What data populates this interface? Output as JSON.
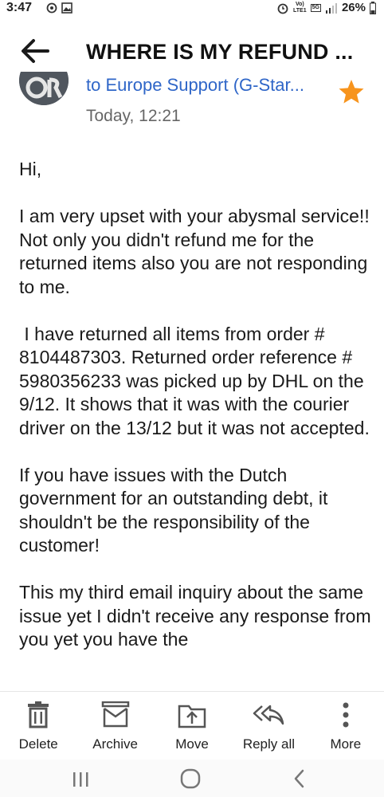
{
  "status_bar": {
    "time": "3:47",
    "volte_label": "Vo)",
    "lte_label": "LTE1",
    "network_label": "5G",
    "battery_percent": "26%"
  },
  "header": {
    "title": "WHERE IS MY REFUND ..."
  },
  "message": {
    "to_word": "to",
    "recipient": "Europe Support (G-Star...",
    "date": "Today, 12:21",
    "starred": true,
    "paragraphs": [
      "Hi,",
      "I am very upset with your abysmal service!! Not only you didn't refund me for the returned items also you are not responding to me.",
      " I have returned all items from order # 8104487303. Returned order reference # 5980356233 was picked up by DHL on the 9/12. It shows that it was with the courier driver on the 13/12 but it was not accepted.",
      "If you have issues with the Dutch government for an outstanding debt, it shouldn't be the responsibility of the customer!",
      "This my third email inquiry about the same issue yet I didn't receive any response from you yet you have the"
    ]
  },
  "toolbar": {
    "delete_label": "Delete",
    "archive_label": "Archive",
    "move_label": "Move",
    "reply_all_label": "Reply all",
    "more_label": "More"
  },
  "colors": {
    "accent_blue": "#2f66c8",
    "star_orange": "#f7941d",
    "icon_gray": "#555555"
  }
}
